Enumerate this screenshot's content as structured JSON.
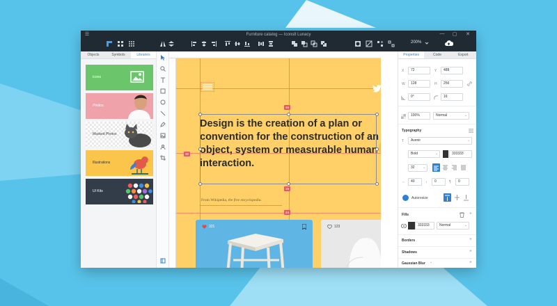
{
  "window": {
    "title": "Furniture catalog — Icons8 Lunacy",
    "zoom": "200%"
  },
  "left_panel": {
    "tabs": [
      {
        "label": "Objects"
      },
      {
        "label": "Symbols"
      },
      {
        "label": "Libraries"
      }
    ],
    "libraries": [
      {
        "label": "Icons"
      },
      {
        "label": "Photos"
      },
      {
        "label": "Masked Photos"
      },
      {
        "label": "Illustrations"
      },
      {
        "label": "UI Kits"
      }
    ]
  },
  "canvas": {
    "headline": "Design is the creation of a plan or convention for the construction of an object, system or measurable human interaction.",
    "credit_source": "From Wikipedia,",
    "credit_rest": "the free encyclopedia.",
    "measurements": {
      "top": "46",
      "left": "32",
      "right": "128",
      "bottom": "15",
      "lower": "24"
    },
    "cards": [
      {
        "likes": "321"
      },
      {
        "likes": "123"
      }
    ]
  },
  "right_panel": {
    "tabs": [
      {
        "label": "Properties"
      },
      {
        "label": "Code"
      },
      {
        "label": "Export"
      }
    ],
    "x": "72",
    "y": "488",
    "w": "128",
    "h": "256",
    "rotation": "0°",
    "radius": "16",
    "opacity": "100%",
    "blend": "Normal",
    "typography_label": "Typography",
    "font": "Avenir",
    "weight": "Bold",
    "text_color": "333333",
    "font_size": "32",
    "letter_spacing": "40",
    "line_height": "0",
    "paragraph_spacing": "0",
    "autoresize": "Autoresize",
    "fills_label": "Fills",
    "fill_color": "333333",
    "fill_blend": "Normal",
    "borders_label": "Borders",
    "shadows_label": "Shadows",
    "blur_label": "Gaussian Blur"
  },
  "colors": {
    "accent": "#2f7fd4",
    "artboard": "#fed067",
    "guide": "#e35b5b",
    "background": "#58c3ea",
    "titlebar": "#1f2a33"
  }
}
